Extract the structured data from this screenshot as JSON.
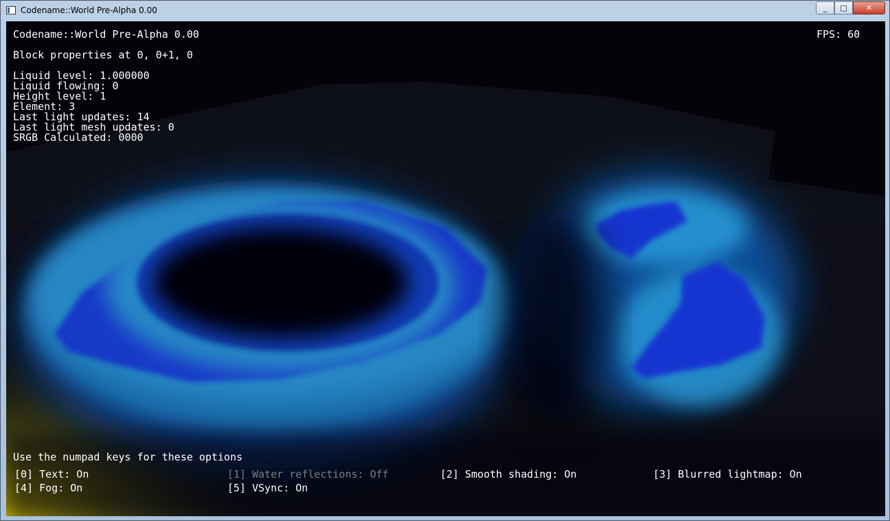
{
  "window": {
    "title": "Codename::World Pre-Alpha 0.00",
    "minimize_glyph": "_",
    "maximize_glyph": "□",
    "close_glyph": "✕"
  },
  "hud": {
    "app_title": "Codename::World Pre-Alpha 0.00",
    "fps_label": "FPS: 60",
    "block_header": "Block properties at 0, 0+1, 0",
    "properties": [
      "Liquid level: 1.000000",
      "Liquid flowing: 0",
      "Height level: 1",
      "Element: 3",
      "Last light updates: 14",
      "Last light mesh updates: 0",
      "SRGB Calculated: 0000"
    ],
    "options_hint": "Use the numpad keys for these options",
    "options": [
      {
        "label": "[0] Text: On",
        "enabled": true
      },
      {
        "label": "[1] Water reflections: Off",
        "enabled": false
      },
      {
        "label": "[2] Smooth shading: On",
        "enabled": true
      },
      {
        "label": "[3] Blurred lightmap: On",
        "enabled": true
      },
      {
        "label": "[4] Fog: On",
        "enabled": true
      },
      {
        "label": "[5] VSync: On",
        "enabled": true
      }
    ]
  },
  "colors": {
    "water": "#1230c8",
    "glow": "#1fb6ff",
    "ground_light": "#d9c400",
    "terrain": "#0c0c14"
  }
}
